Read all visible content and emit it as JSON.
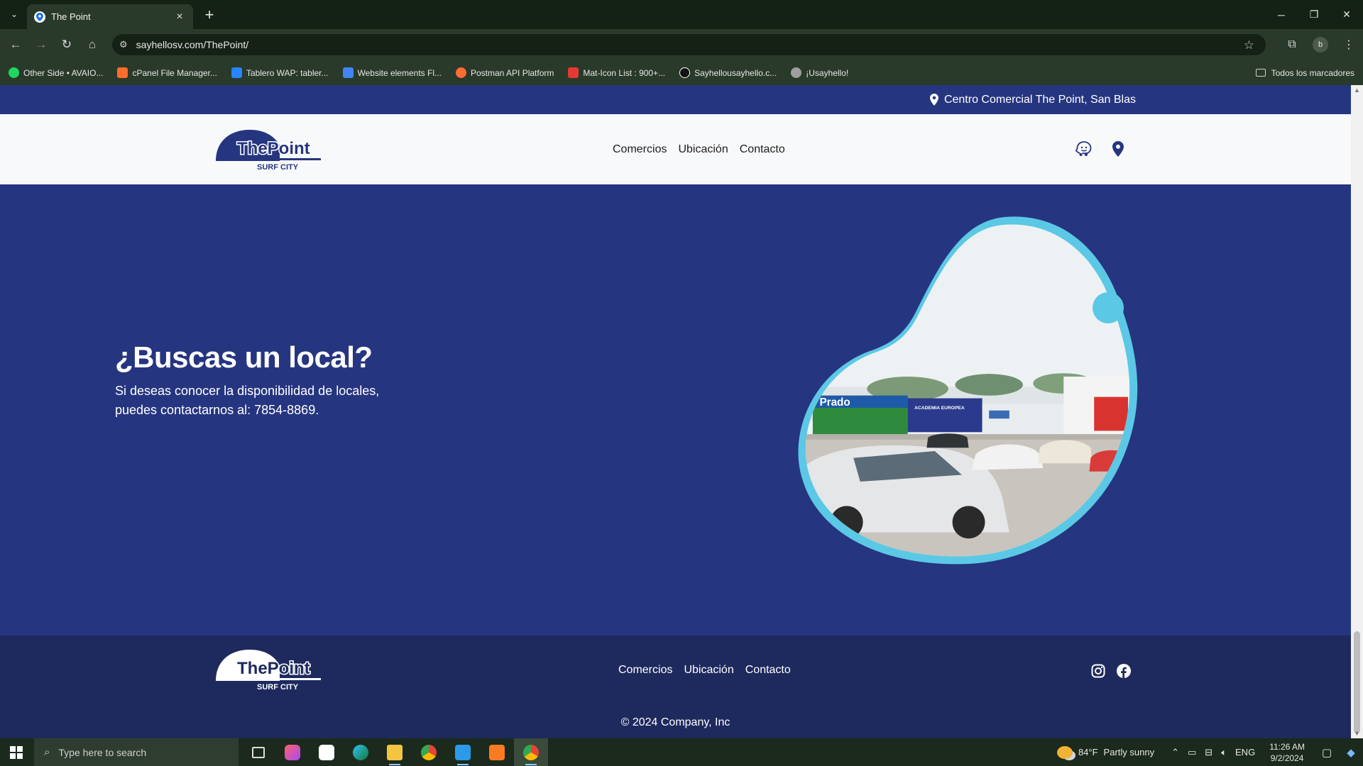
{
  "browser": {
    "tab_title": "The Point",
    "url": "sayhellosv.com/ThePoint/",
    "profile_initial": "b",
    "bookmarks": [
      {
        "label": "Other Side • AVAIO...",
        "color": "#1ed760"
      },
      {
        "label": "cPanel File Manager...",
        "color": "#ff6c2c"
      },
      {
        "label": "Tablero WAP: tabler...",
        "color": "#2684ff"
      },
      {
        "label": "Website elements Fl...",
        "color": "#4285f4"
      },
      {
        "label": "Postman API Platform",
        "color": "#ff6c37"
      },
      {
        "label": "Mat-Icon List : 900+...",
        "color": "#e53935"
      },
      {
        "label": "Sayhellousayhello.c...",
        "color": "#111111"
      },
      {
        "label": "¡Usayhello!",
        "color": "#9e9e9e"
      }
    ],
    "all_bookmarks": "Todos los marcadores"
  },
  "site": {
    "topbar_location": "Centro Comercial The Point, San Blas",
    "logo_main": "ThePoint",
    "logo_sub": "SURF CITY",
    "nav": [
      "Comercios",
      "Ubicación",
      "Contacto"
    ],
    "hero_title": "¿Buscas un local?",
    "hero_text": "Si deseas conocer la disponibilidad de locales, puedes contactarnos al: 7854-8869.",
    "photo_sign": "Prado",
    "photo_sign2": "ACADEMIA EUROPEA",
    "footer_nav": [
      "Comercios",
      "Ubicación",
      "Contacto"
    ],
    "copyright": "© 2024 Company, Inc",
    "colors": {
      "primary": "#263580",
      "accent": "#5bc8e6",
      "footer": "#1e2a5e",
      "header_bg": "#f8f9fb"
    }
  },
  "taskbar": {
    "search_placeholder": "Type here to search",
    "weather_temp": "84°F",
    "weather_desc": "Partly sunny",
    "language": "ENG",
    "time": "11:26 AM",
    "date": "9/2/2024",
    "apps": [
      "task-view-icon",
      "photo-editor-icon",
      "capcut-icon",
      "edge-icon",
      "file-explorer-icon",
      "chrome-icon",
      "vscode-icon",
      "xampp-icon",
      "chrome-profile-icon"
    ]
  }
}
